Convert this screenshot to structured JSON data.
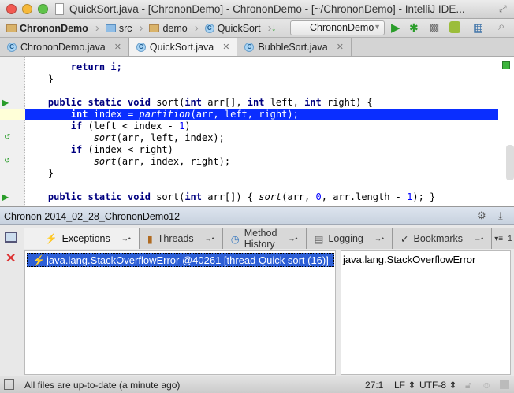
{
  "window": {
    "title": "QuickSort.java - [ChrononDemo] - ChrononDemo - [~/ChrononDemo] - IntelliJ IDE..."
  },
  "navbar": {
    "crumbs": [
      "ChrononDemo",
      "src",
      "demo",
      "QuickSort"
    ],
    "run_config": "ChrononDemo"
  },
  "tabs": [
    {
      "label": "ChrononDemo.java"
    },
    {
      "label": "QuickSort.java",
      "active": true
    },
    {
      "label": "BubbleSort.java"
    }
  ],
  "code": {
    "l1": "return i;",
    "l2": "}",
    "l4a": "public static void ",
    "l4b": "sort(",
    "l4c": "int ",
    "l4d": "arr[], ",
    "l4e": "int ",
    "l4f": "left, ",
    "l4g": "int ",
    "l4h": "right) {",
    "l5a": "int ",
    "l5b": "index = ",
    "l5c": "partition",
    "l5d": "(arr, left, right);",
    "l6a": "if ",
    "l6b": "(left < index - ",
    "l6c": "1",
    "l6d": ")",
    "l7a": "sort",
    "l7b": "(arr, left, index);",
    "l8a": "if ",
    "l8b": "(index < right)",
    "l9a": "sort",
    "l9b": "(arr, index, right);",
    "l10": "}",
    "l12a": "public static void ",
    "l12b": "sort(",
    "l12c": "int ",
    "l12d": "arr[]) { ",
    "l12e": "sort",
    "l12f": "(arr, ",
    "l12g": "0",
    "l12h": ", arr.length - ",
    "l12i": "1",
    "l12j": "); }"
  },
  "chronon": {
    "title": "Chronon 2014_02_28_ChrononDemo12",
    "tabs": [
      {
        "label": "Exceptions",
        "active": true
      },
      {
        "label": "Threads"
      },
      {
        "label": "Method History"
      },
      {
        "label": "Logging"
      },
      {
        "label": "Bookmarks"
      }
    ],
    "overflow": "1",
    "exceptions": [
      {
        "label": "java.lang.StackOverflowError @40261 [thread Quick sort (16)]",
        "selected": true
      }
    ],
    "detail": "java.lang.StackOverflowError"
  },
  "status": {
    "message": "All files are up-to-date (a minute ago)",
    "position": "27:1",
    "line_sep": "LF",
    "encoding": "UTF-8"
  },
  "colors": {
    "selection": "#0a2eff",
    "keyword": "#000080",
    "run_green": "#2a9d2a"
  }
}
